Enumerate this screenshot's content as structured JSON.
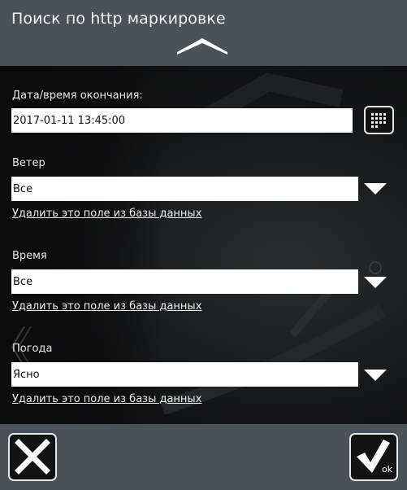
{
  "header": {
    "title": "Поиск по http маркировке"
  },
  "form": {
    "end_datetime": {
      "label": "Дата/время окончания:",
      "value": "2017-01-11 13:45:00"
    },
    "wind": {
      "label": "Ветер",
      "value": "Все",
      "remove_link": "Удалить это поле из базы данных"
    },
    "time": {
      "label": "Время",
      "value": "Все",
      "remove_link": "Удалить это поле из базы данных"
    },
    "weather": {
      "label": "Погода",
      "value": "Ясно",
      "remove_link": "Удалить это поле из базы данных"
    }
  },
  "footer": {
    "ok_label": "ok"
  },
  "icons": {
    "collapse": "chevron-up-icon",
    "calendar": "calendar-icon",
    "dropdown": "triangle-down-icon",
    "cancel": "close-icon",
    "confirm": "checkmark-icon"
  },
  "colors": {
    "header_bg": "#4b5158",
    "content_bg": "#141516",
    "field_bg": "#ffffff",
    "text": "#ffffff"
  }
}
